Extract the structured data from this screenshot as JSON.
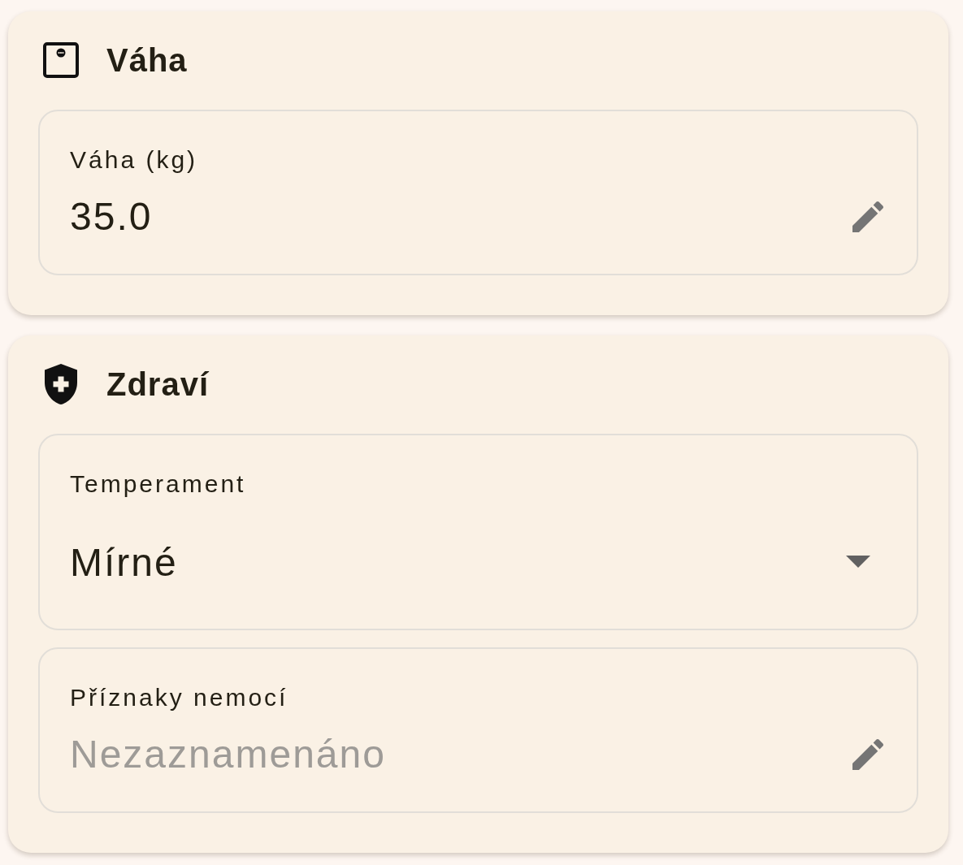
{
  "sections": [
    {
      "kind": "weight",
      "title": "Váha",
      "fields": [
        {
          "kind": "text",
          "label": "Váha (kg)",
          "value": "35.0"
        }
      ]
    },
    {
      "kind": "health",
      "title": "Zdraví",
      "fields": [
        {
          "kind": "select",
          "label": "Temperament",
          "value": "Mírné"
        },
        {
          "kind": "text",
          "label": "Příznaky nemocí",
          "placeholder": "Nezaznamenáno"
        }
      ]
    }
  ]
}
